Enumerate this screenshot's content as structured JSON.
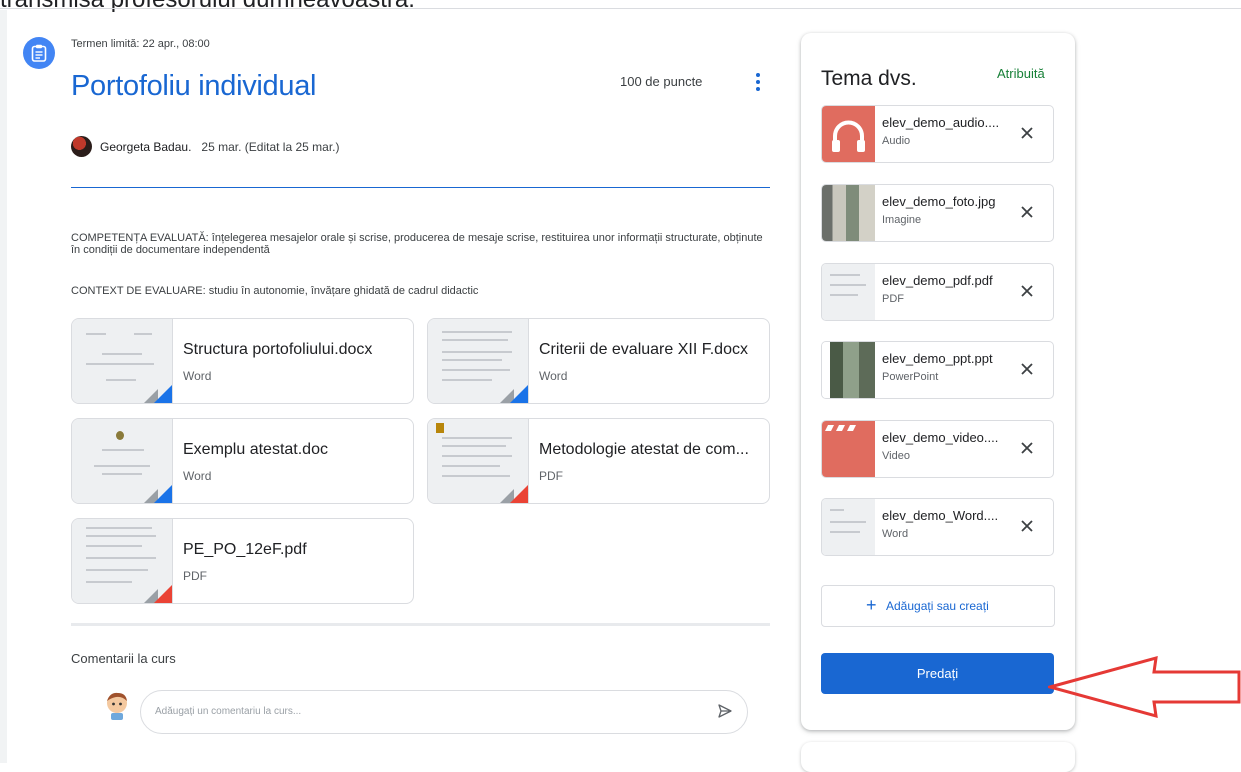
{
  "caption": "transmisă profesorului dumneavoastră.",
  "assignment": {
    "deadline": "Termen limită: 22 apr., 08:00",
    "title": "Portofoliu individual",
    "points": "100 de puncte",
    "author": "Georgeta Badau.",
    "date": "25 mar. (Editat la 25 mar.)",
    "description_1": "COMPETENȚA EVALUATĂ: înțelegerea mesajelor orale și scrise, producerea de mesaje scrise, restituirea unor informații structurate, obținute în condiții de documentare independentă",
    "description_2": "CONTEXT DE EVALUARE: studiu în autonomie, învățare ghidată de cadrul didactic"
  },
  "attachments": [
    {
      "name": "Structura portofoliului.docx",
      "type": "Word",
      "icon": "word-icon"
    },
    {
      "name": "Criterii de evaluare XII F.docx",
      "type": "Word",
      "icon": "word-icon"
    },
    {
      "name": "Exemplu atestat.doc",
      "type": "Word",
      "icon": "word-icon"
    },
    {
      "name": "Metodologie atestat de com...",
      "type": "PDF",
      "icon": "pdf-icon"
    },
    {
      "name": "PE_PO_12eF.pdf",
      "type": "PDF",
      "icon": "pdf-icon"
    }
  ],
  "comments": {
    "title": "Comentarii la curs",
    "placeholder": "Adăugați un comentariu la curs..."
  },
  "work_panel": {
    "title": "Tema dvs.",
    "status": "Atribuită",
    "files": [
      {
        "name": "elev_demo_audio....",
        "type": "Audio",
        "icon": "headphones-icon"
      },
      {
        "name": "elev_demo_foto.jpg",
        "type": "Imagine",
        "icon": "image-icon"
      },
      {
        "name": "elev_demo_pdf.pdf",
        "type": "PDF",
        "icon": "pdf-icon"
      },
      {
        "name": "elev_demo_ppt.ppt",
        "type": "PowerPoint",
        "icon": "powerpoint-icon"
      },
      {
        "name": "elev_demo_video....",
        "type": "Video",
        "icon": "clapperboard-icon"
      },
      {
        "name": "elev_demo_Word....",
        "type": "Word",
        "icon": "word-icon"
      }
    ],
    "add_label": "Adăugați sau creați",
    "submit_label": "Predați"
  },
  "colors": {
    "accent": "#1967d2",
    "status_green": "#188038",
    "annotation_red": "#e53935"
  }
}
